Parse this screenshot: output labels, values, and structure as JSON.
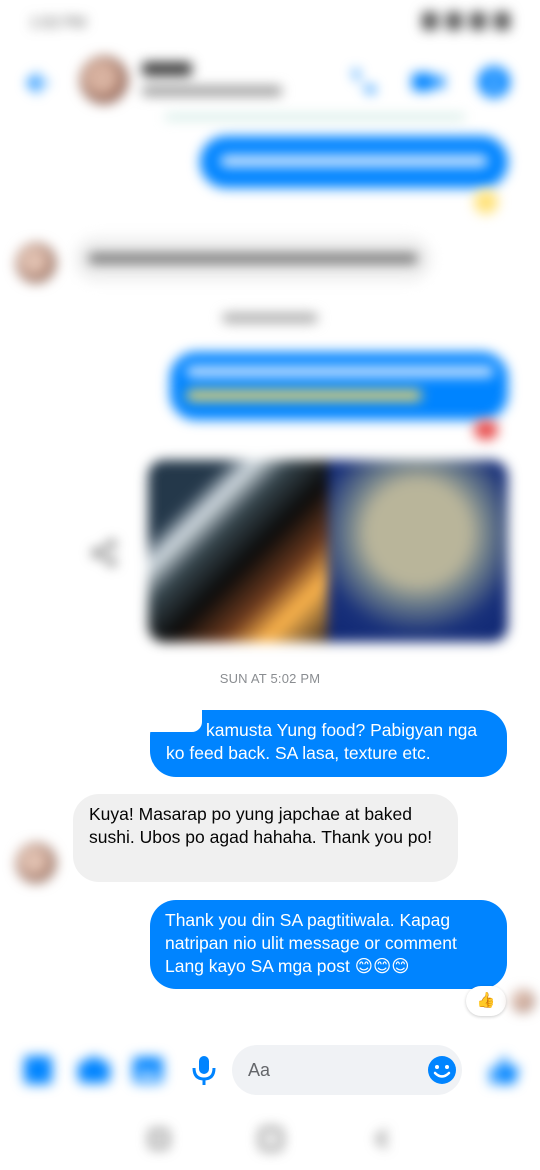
{
  "status_bar": {
    "time": "1:02 PM"
  },
  "conversation": {
    "timestamp": "SUN AT 5:02 PM",
    "messages": [
      {
        "dir": "out",
        "text": "kamusta Yung food? Pabigyan nga ko feed back. SA lasa, texture etc."
      },
      {
        "dir": "in",
        "text": "Kuya! Masarap po yung japchae at baked sushi. Ubos po agad hahaha. Thank you po!"
      },
      {
        "dir": "out",
        "text": "Thank you din SA pagtitiwala. Kapag natripan nio ulit message or comment Lang kayo SA mga post 😊😊😊"
      }
    ],
    "reaction": "👍"
  },
  "composer": {
    "placeholder": "Aa"
  },
  "colors": {
    "accent": "#0084ff",
    "incoming_bubble": "#f0f0f0"
  }
}
